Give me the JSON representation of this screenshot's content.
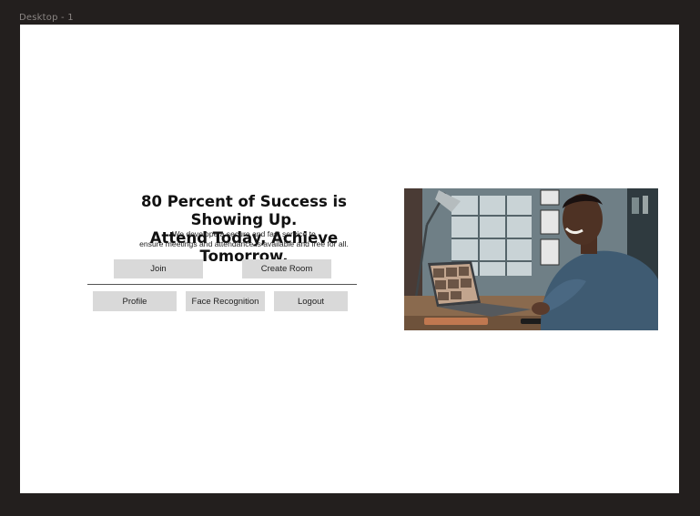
{
  "frame": {
    "label": "Desktop - 1"
  },
  "hero": {
    "title_line1": "80 Percent of Success is Showing Up.",
    "title_line2": "Attend Today, Achieve Tomorrow.",
    "subtitle_line1": "We develope a secure and fast service to",
    "subtitle_line2": "ensure meetings and attendance is available and free for all."
  },
  "actions": {
    "join": "Join",
    "create_room": "Create Room",
    "profile": "Profile",
    "face_recognition": "Face Recognition",
    "logout": "Logout"
  },
  "image": {
    "subject": "man smiling at laptop during video call"
  },
  "colors": {
    "page_bg": "#231f1e",
    "frame_bg": "#ffffff",
    "button_bg": "#d9d9d9"
  }
}
